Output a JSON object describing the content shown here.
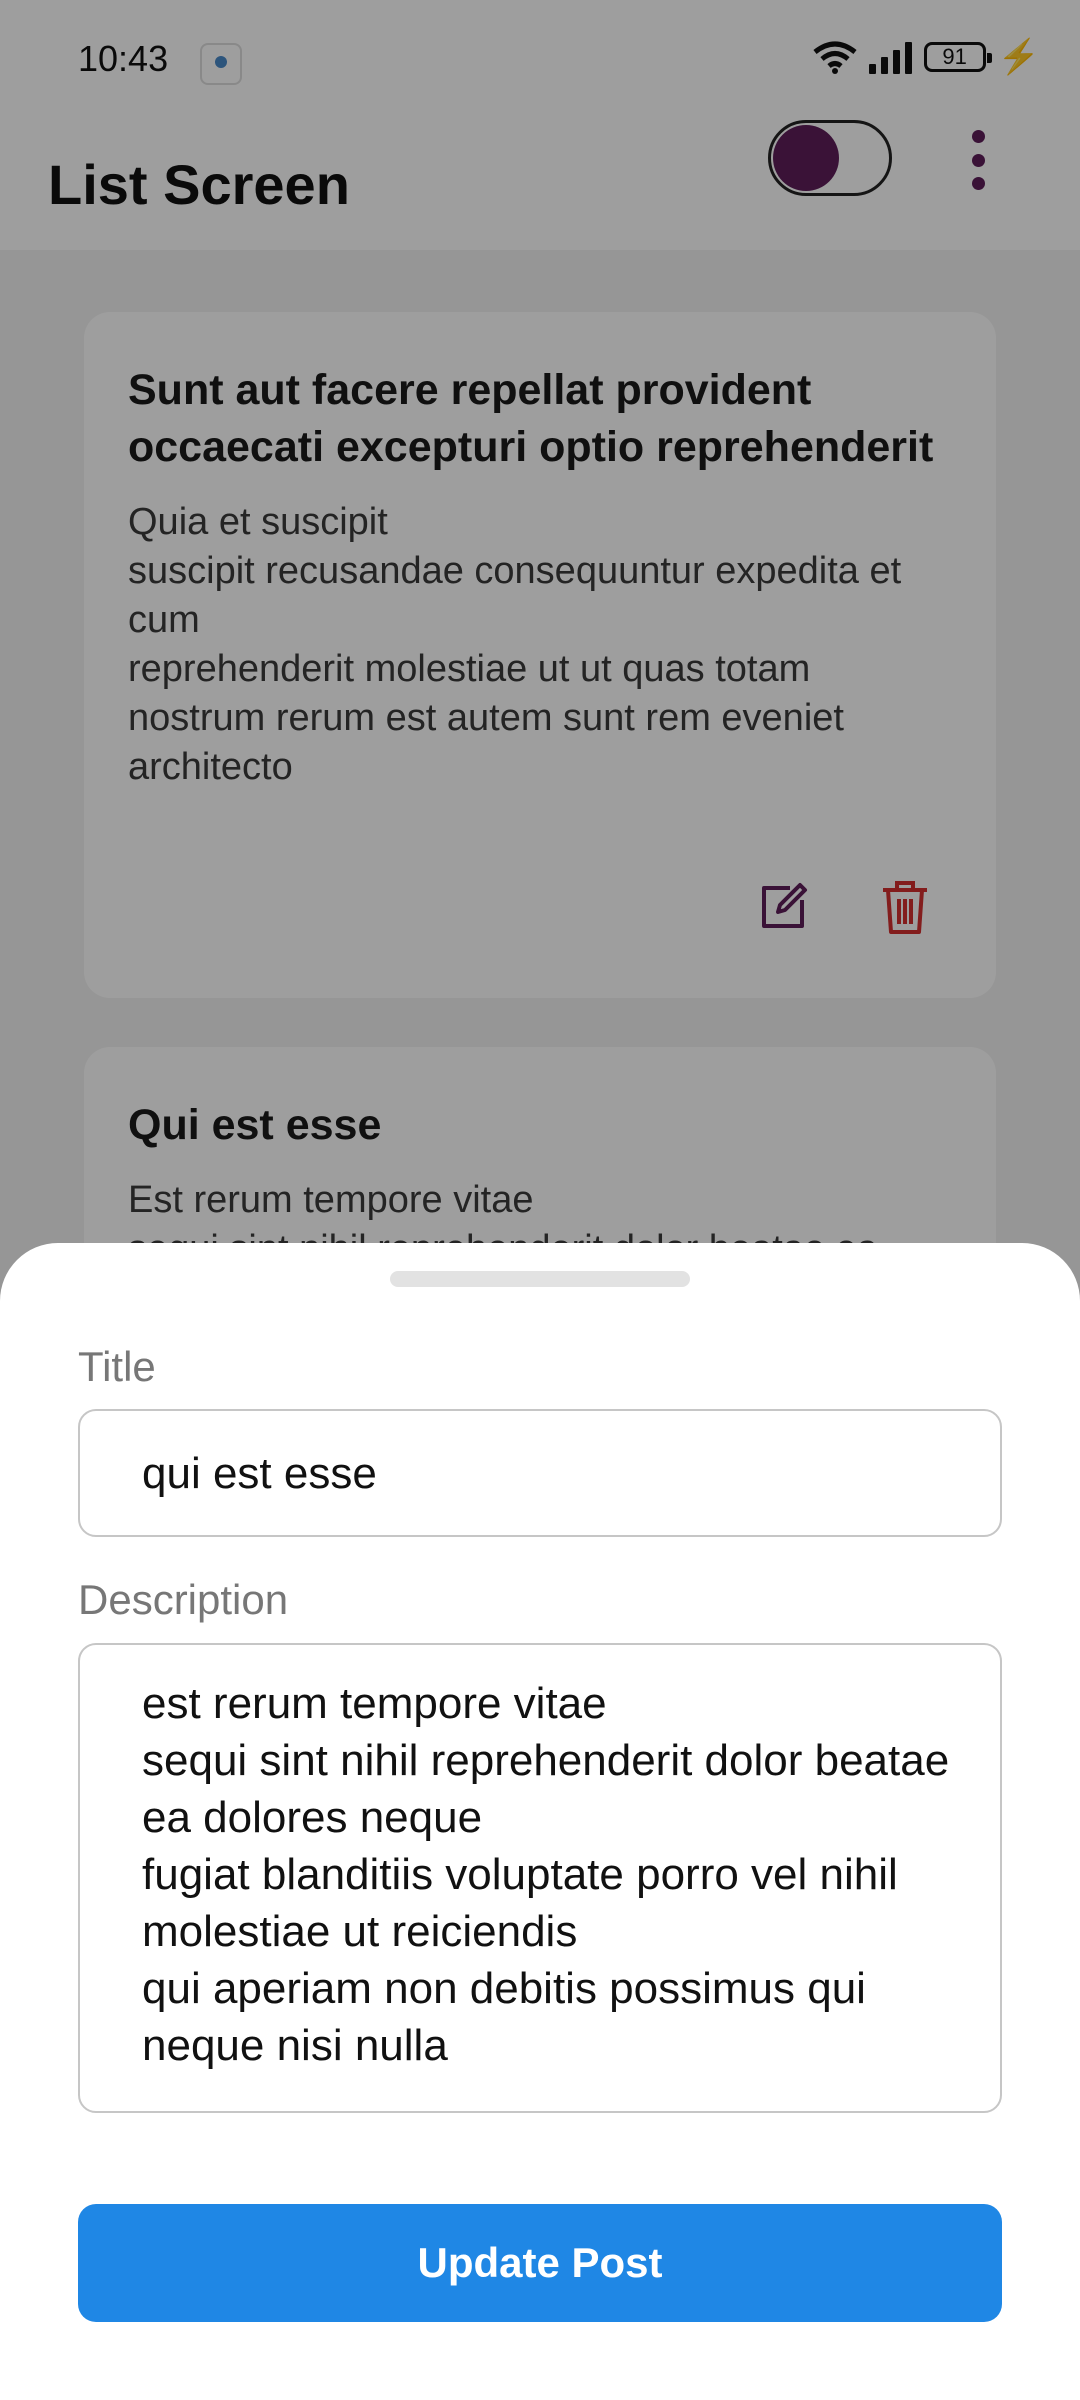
{
  "status_bar": {
    "time": "10:43",
    "battery": "91",
    "app_icon": "app-notification-icon",
    "wifi_icon": "wifi-icon",
    "signal_icon": "signal-icon",
    "charging_icon": "charging-bolt-icon"
  },
  "app_bar": {
    "title": "List Screen",
    "toggle_state": "on",
    "menu_icon": "more-vert-icon"
  },
  "posts": [
    {
      "title": "Sunt aut facere repellat provident occaecati excepturi optio reprehenderit",
      "body": "Quia et suscipit\nsuscipit recusandae consequuntur expedita et cum\nreprehenderit molestiae ut ut quas totam\nnostrum rerum est autem sunt rem eveniet architecto",
      "edit_icon": "edit-icon",
      "delete_icon": "delete-icon"
    },
    {
      "title": "Qui est esse",
      "body": "Est rerum tempore vitae\nsequi sint nihil reprehenderit dolor beatae ea"
    }
  ],
  "edit_sheet": {
    "title_label": "Title",
    "title_value": "qui est esse",
    "description_label": "Description",
    "description_value": "est rerum tempore vitae\nsequi sint nihil reprehenderit dolor beatae ea dolores neque\nfugiat blanditiis voluptate porro vel nihil molestiae ut reiciendis\nqui aperiam non debitis possimus qui neque nisi nulla",
    "submit_label": "Update Post"
  },
  "colors": {
    "accent_purple": "#5e1d5a",
    "delete_red": "#d32f2f",
    "primary_blue": "#1f87e5"
  }
}
